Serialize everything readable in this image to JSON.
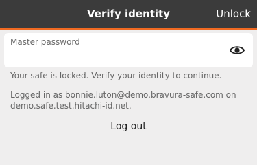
{
  "header": {
    "title": "Verify identity",
    "unlock_label": "Unlock",
    "accent_color": "#f06a22",
    "background_color": "#3b3b3b"
  },
  "password_field": {
    "label": "Master password",
    "value": "",
    "toggle_icon": "eye-icon"
  },
  "messages": {
    "locked": "Your safe is locked. Verify your identity to continue.",
    "logged_in": "Logged in as bonnie.luton@demo.bravura-safe.com on demo.safe.test.hitachi-id.net."
  },
  "logout_label": "Log out"
}
